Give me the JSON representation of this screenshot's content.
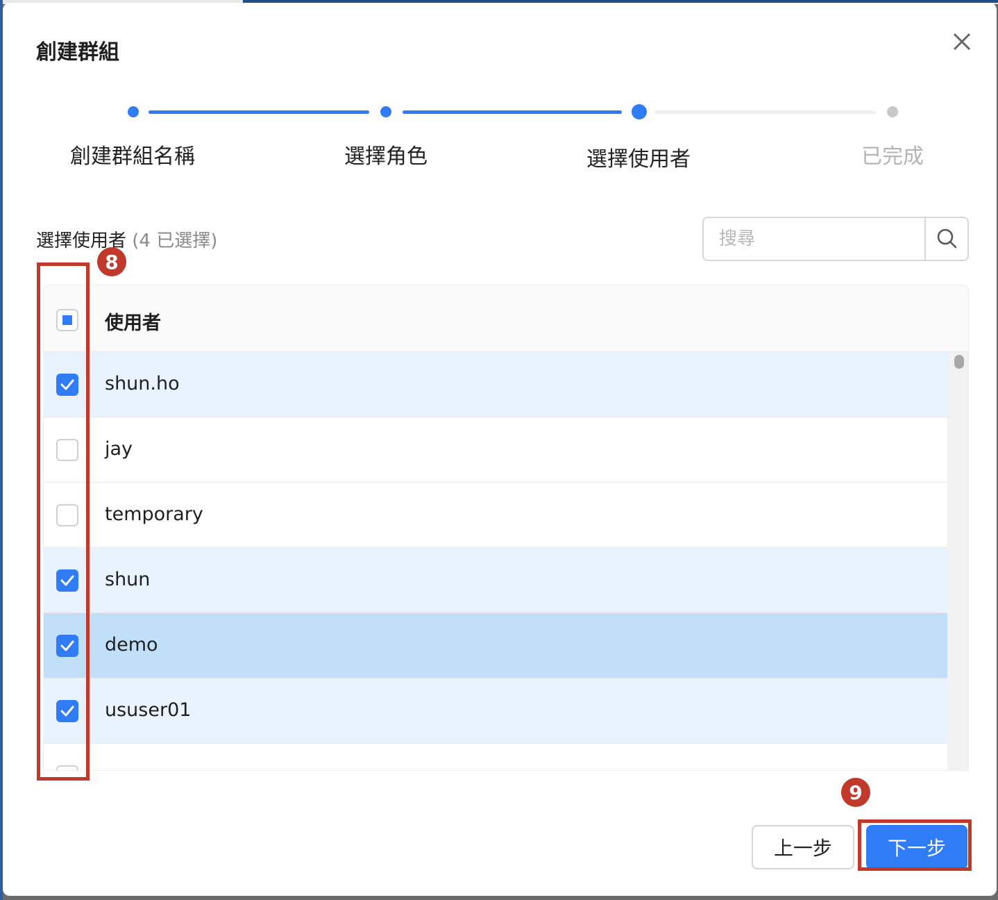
{
  "modal": {
    "title": "創建群組"
  },
  "steps": [
    {
      "label": "創建群組名稱",
      "status": "done"
    },
    {
      "label": "選擇角色",
      "status": "done"
    },
    {
      "label": "選擇使用者",
      "status": "current"
    },
    {
      "label": "已完成",
      "status": "pending"
    }
  ],
  "section": {
    "label": "選擇使用者",
    "count_text": "(4 已選擇)"
  },
  "search": {
    "placeholder": "搜尋",
    "icon": "search-icon"
  },
  "table": {
    "header": "使用者",
    "header_checkbox_state": "indeterminate",
    "rows": [
      {
        "name": "shun.ho",
        "checked": true
      },
      {
        "name": "jay",
        "checked": false
      },
      {
        "name": "temporary",
        "checked": false
      },
      {
        "name": "shun",
        "checked": true
      },
      {
        "name": "demo",
        "checked": true
      },
      {
        "name": "ususer01",
        "checked": true
      }
    ]
  },
  "footer": {
    "prev_label": "上一步",
    "next_label": "下一步"
  },
  "annotations": {
    "badge_checkboxes": "8",
    "badge_next": "9"
  },
  "colors": {
    "primary": "#2f7cf6",
    "selected_row": "#e8f3ff",
    "hover_row": "#c2dffa",
    "annotation": "#c0392b",
    "pending": "#b4b4b4"
  }
}
